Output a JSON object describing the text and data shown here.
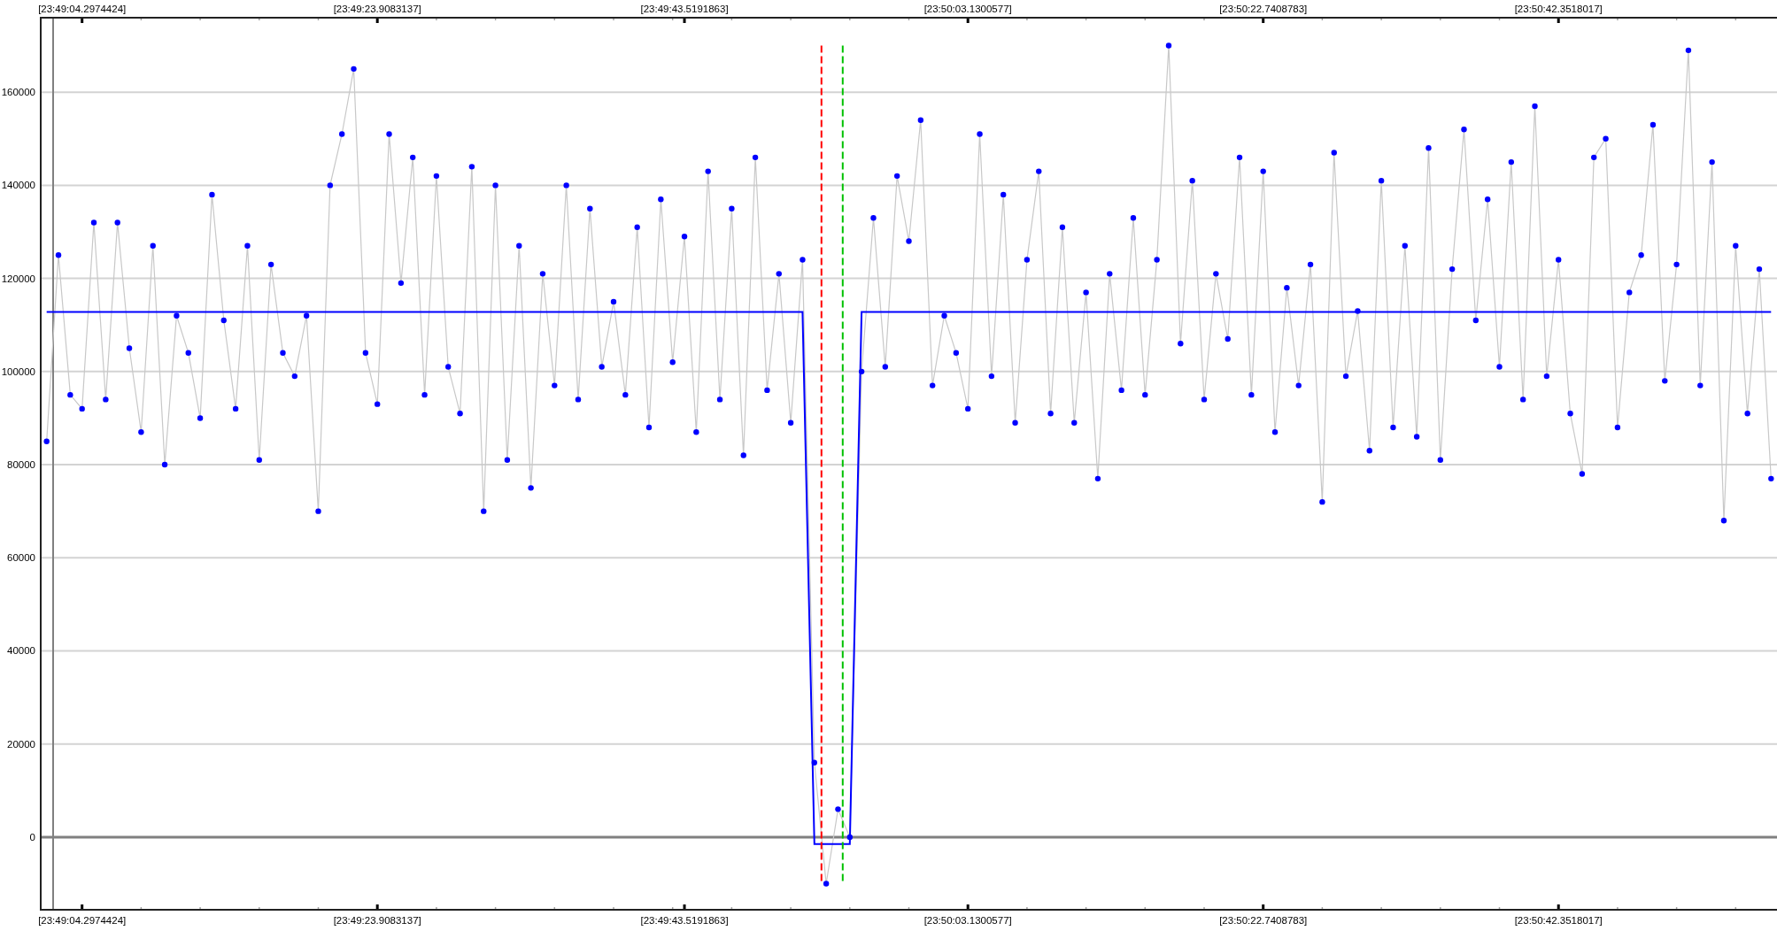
{
  "top_axis": {
    "labels": [
      "[23:49:04.2974424]",
      "[23:49:23.9083137]",
      "[23:49:43.5191863]",
      "[23:50:03.1300577]",
      "[23:50:22.7408783]",
      "[23:50:42.3518017]"
    ]
  },
  "chart_data": {
    "type": "line",
    "grid": true,
    "ylim": [
      -15600,
      176000
    ],
    "yticks": [
      0,
      20000,
      40000,
      60000,
      80000,
      100000,
      120000,
      140000,
      160000
    ],
    "categories": [
      null,
      null,
      null,
      "[23:49:04.2974424]",
      null,
      null,
      null,
      null,
      null,
      null,
      null,
      null,
      null,
      null,
      null,
      null,
      null,
      null,
      null,
      null,
      null,
      null,
      null,
      null,
      null,
      null,
      null,
      null,
      "[23:49:23.9083137]",
      null,
      null,
      null,
      null,
      null,
      null,
      null,
      null,
      null,
      null,
      null,
      null,
      null,
      null,
      null,
      null,
      null,
      null,
      null,
      null,
      null,
      null,
      null,
      null,
      null,
      "[23:49:43.5191863]",
      null,
      null,
      null,
      null,
      null,
      null,
      null,
      null,
      null,
      null,
      null,
      null,
      null,
      null,
      null,
      null,
      null,
      null,
      null,
      null,
      null,
      null,
      null,
      "[23:50:03.1300577]",
      null,
      null,
      null,
      null,
      null,
      null,
      null,
      null,
      null,
      null,
      null,
      null,
      null,
      null,
      null,
      null,
      null,
      null,
      null,
      null,
      null,
      null,
      null,
      null,
      "[23:50:22.7408783]",
      null,
      null,
      null,
      null,
      null,
      null,
      null,
      null,
      null,
      null,
      null,
      null,
      null,
      null,
      null,
      null,
      null,
      null,
      null,
      null,
      null,
      null,
      null,
      null,
      "[23:50:42.3518017]",
      null,
      null,
      null,
      null,
      null,
      null,
      null,
      null,
      null,
      null,
      null,
      null,
      null,
      null,
      null,
      null,
      null,
      null
    ],
    "series": [
      {
        "color": "#0000ff",
        "marker": "circle",
        "values": [
          85000,
          125000,
          95000,
          92000,
          132000,
          94000,
          132000,
          105000,
          87000,
          127000,
          80000,
          112000,
          104000,
          90000,
          138000,
          111000,
          92000,
          127000,
          81000,
          123000,
          104000,
          99000,
          112000,
          70000,
          140000,
          151000,
          165000,
          104000,
          93000,
          151000,
          119000,
          146000,
          95000,
          142000,
          101000,
          91000,
          144000,
          70000,
          140000,
          81000,
          127000,
          75000,
          121000,
          97000,
          140000,
          94000,
          135000,
          101000,
          115000,
          95000,
          131000,
          88000,
          137000,
          102000,
          129000,
          87000,
          143000,
          94000,
          135000,
          82000,
          146000,
          96000,
          121000,
          89000,
          124000,
          16000,
          -10000,
          6000,
          0,
          100000,
          133000,
          101000,
          142000,
          128000,
          154000,
          97000,
          112000,
          104000,
          92000,
          151000,
          99000,
          138000,
          89000,
          124000,
          143000,
          91000,
          131000,
          89000,
          117000,
          77000,
          121000,
          96000,
          133000,
          95000,
          124000,
          170000,
          106000,
          141000,
          94000,
          121000,
          107000,
          146000,
          95000,
          143000,
          87000,
          118000,
          97000,
          123000,
          72000,
          147000,
          99000,
          113000,
          83000,
          141000,
          88000,
          127000,
          86000,
          148000,
          81000,
          122000,
          152000,
          111000,
          137000,
          101000,
          145000,
          94000,
          157000,
          99000,
          124000,
          91000,
          78000,
          146000,
          150000,
          88000,
          117000,
          125000,
          153000,
          98000,
          123000,
          169000,
          97000,
          145000,
          68000,
          127000,
          91000,
          122000,
          77000
        ]
      },
      {
        "color": "#0000ff",
        "values": [
          112800,
          112800,
          112800,
          112800,
          112800,
          112800,
          112800,
          112800,
          112800,
          112800,
          112800,
          112800,
          112800,
          112800,
          112800,
          112800,
          112800,
          112800,
          112800,
          112800,
          112800,
          112800,
          112800,
          112800,
          112800,
          112800,
          112800,
          112800,
          112800,
          112800,
          112800,
          112800,
          112800,
          112800,
          112800,
          112800,
          112800,
          112800,
          112800,
          112800,
          112800,
          112800,
          112800,
          112800,
          112800,
          112800,
          112800,
          112800,
          112800,
          112800,
          112800,
          112800,
          112800,
          112800,
          112800,
          112800,
          112800,
          112800,
          112800,
          112800,
          112800,
          112800,
          112800,
          112800,
          112800,
          -1500,
          -1500,
          -1500,
          -1500,
          112800,
          112800,
          112800,
          112800,
          112800,
          112800,
          112800,
          112800,
          112800,
          112800,
          112800,
          112800,
          112800,
          112800,
          112800,
          112800,
          112800,
          112800,
          112800,
          112800,
          112800,
          112800,
          112800,
          112800,
          112800,
          112800,
          112800,
          112800,
          112800,
          112800,
          112800,
          112800,
          112800,
          112800,
          112800,
          112800,
          112800,
          112800,
          112800,
          112800,
          112800,
          112800,
          112800,
          112800,
          112800,
          112800,
          112800,
          112800,
          112800,
          112800,
          112800,
          112800,
          112800,
          112800,
          112800,
          112800,
          112800,
          112800,
          112800,
          112800,
          112800,
          112800,
          112800,
          112800,
          112800,
          112800,
          112800,
          112800,
          112800,
          112800,
          112800,
          112800,
          112800,
          112800,
          112800,
          112800,
          112800,
          112800
        ]
      }
    ]
  }
}
